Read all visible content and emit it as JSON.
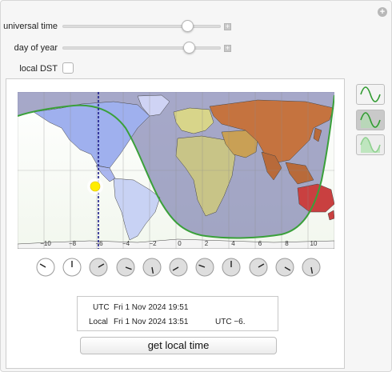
{
  "controls": {
    "universal_time_label": "universal time",
    "day_of_year_label": "day of year",
    "local_dst_label": "local DST",
    "universal_time_value": 0.82,
    "day_of_year_value": 0.84,
    "local_dst_checked": false
  },
  "map": {
    "longitude_ticks": [
      "−10",
      "−8",
      "−6",
      "−4",
      "−2",
      "0",
      "2",
      "4",
      "6",
      "8",
      "10"
    ],
    "selected_zone_marker": "dashed-vertical-line",
    "colors": {
      "terminator": "#3aa03a",
      "night_shade": "#6f73a8",
      "sun": "#ffec00",
      "marker_line": "#1c1c8c"
    }
  },
  "clocks_count": 11,
  "readout": {
    "utc_label": "UTC",
    "utc_value": "Fri 1 Nov 2024 19:51",
    "local_label": "Local",
    "local_value": "Fri 1 Nov 2024 13:51",
    "offset": "UTC −6."
  },
  "get_local_time_button": "get local time"
}
